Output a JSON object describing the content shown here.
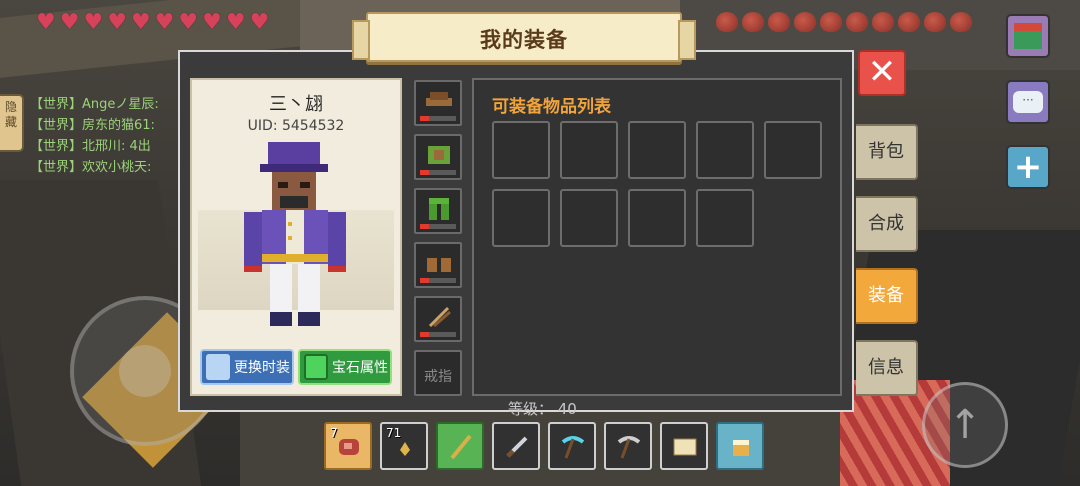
{
  "panel": {
    "title": "我的装备",
    "close_symbol": "✕"
  },
  "character": {
    "name": "三丶翃",
    "uid": "UID: 5454532",
    "change_skin_label": "更换时装",
    "gem_attr_label": "宝石属性"
  },
  "equipment_slots": [
    {
      "name": "helmet",
      "icon": "hat-icon",
      "durability_percent": 25
    },
    {
      "name": "chest",
      "icon": "armor-icon",
      "durability_percent": 25
    },
    {
      "name": "legs",
      "icon": "pants-icon",
      "durability_percent": 25
    },
    {
      "name": "boots",
      "icon": "boots-icon",
      "durability_percent": 25
    },
    {
      "name": "quiver",
      "icon": "arrows-icon",
      "durability_percent": 25
    },
    {
      "name": "ring",
      "label": "戒指"
    }
  ],
  "inventory": {
    "title": "可装备物品列表",
    "slot_count": 9
  },
  "side_tabs": [
    {
      "label": "背包",
      "active": false
    },
    {
      "label": "合成",
      "active": false
    },
    {
      "label": "装备",
      "active": true
    },
    {
      "label": "信息",
      "active": false
    }
  ],
  "level_text": "等级： 40",
  "chat": {
    "hide_label": "隐藏",
    "lines": [
      "【世界】Angeノ星辰:",
      "【世界】房东的猫61:",
      "【世界】北邢川:   4出",
      "【世界】欢欢小桃天:"
    ]
  },
  "hud": {
    "hearts": 10,
    "food": 10,
    "jump_symbol": "↑"
  },
  "hotbar": [
    {
      "count": "7",
      "icon": "meat-icon"
    },
    {
      "count": "71",
      "icon": "arrow-icon"
    },
    {
      "count": "",
      "icon": "staff-icon"
    },
    {
      "count": "",
      "icon": "sword-icon"
    },
    {
      "count": "",
      "icon": "pickaxe-icon"
    },
    {
      "count": "",
      "icon": "stone-pickaxe-icon"
    },
    {
      "count": "",
      "icon": "map-icon"
    },
    {
      "count": "",
      "icon": "bucket-icon"
    }
  ],
  "colors": {
    "accent_orange": "#f3a83c",
    "close_red": "#e9524b",
    "title_text": "#5b3a1c"
  }
}
